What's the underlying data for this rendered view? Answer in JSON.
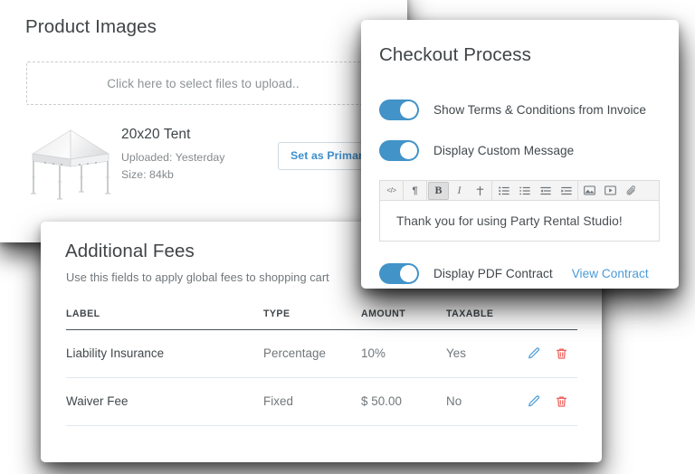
{
  "product_images": {
    "title": "Product Images",
    "dropzone_text": "Click here to select files to upload..",
    "media": {
      "name": "20x20 Tent",
      "uploaded": "Uploaded: Yesterday",
      "size": "Size: 84kb",
      "image_alt": "20x20 white canopy tent",
      "set_primary_label": "Set as Primary"
    }
  },
  "checkout_process": {
    "title": "Checkout Process",
    "toggles": [
      {
        "label": "Show Terms & Conditions from Invoice",
        "state": "on"
      },
      {
        "label": "Display Custom Message",
        "state": "on"
      },
      {
        "label": "Display PDF Contract",
        "state": "on",
        "link_label": "View Contract"
      }
    ],
    "editor": {
      "content": "Thank you for using Party Rental Studio!",
      "toolbar_buttons": [
        {
          "name": "source-code-icon",
          "glyph": "</>",
          "active": false
        },
        {
          "name": "paragraph-format-icon",
          "glyph": "¶",
          "active": false
        },
        {
          "name": "bold-icon",
          "glyph": "B",
          "active": true
        },
        {
          "name": "italic-icon",
          "glyph": "I",
          "active": false
        },
        {
          "name": "strikethrough-icon",
          "glyph": "Ŧ",
          "active": false
        },
        {
          "name": "unordered-list-icon",
          "glyph": "list",
          "active": false
        },
        {
          "name": "ordered-list-icon",
          "glyph": "list",
          "active": false
        },
        {
          "name": "outdent-icon",
          "glyph": "indent",
          "active": false
        },
        {
          "name": "indent-icon",
          "glyph": "indent",
          "active": false
        },
        {
          "name": "insert-image-icon",
          "glyph": "image",
          "active": false
        },
        {
          "name": "insert-video-icon",
          "glyph": "video",
          "active": false
        },
        {
          "name": "attach-file-icon",
          "glyph": "paperclip",
          "active": false
        }
      ]
    }
  },
  "additional_fees": {
    "title": "Additional Fees",
    "subtitle": "Use this fields to apply global fees to shopping cart",
    "columns": [
      "LABEL",
      "TYPE",
      "AMOUNT",
      "TAXABLE"
    ],
    "rows": [
      {
        "label": "Liability Insurance",
        "type": "Percentage",
        "amount": "10%",
        "taxable": "Yes"
      },
      {
        "label": "Waiver Fee",
        "type": "Fixed",
        "amount": "$ 50.00",
        "taxable": "No"
      }
    ],
    "row_actions": [
      {
        "name": "edit-icon",
        "title": "Edit"
      },
      {
        "name": "delete-icon",
        "title": "Delete"
      }
    ]
  },
  "colors": {
    "accent_blue": "#4193c8",
    "link_blue": "#4a9bd8",
    "edit_blue": "#4a9bd8",
    "delete_red": "#ef5350",
    "heading_text": "#3f4447",
    "muted_text": "#70767a",
    "card_bg": "#ffffff"
  }
}
